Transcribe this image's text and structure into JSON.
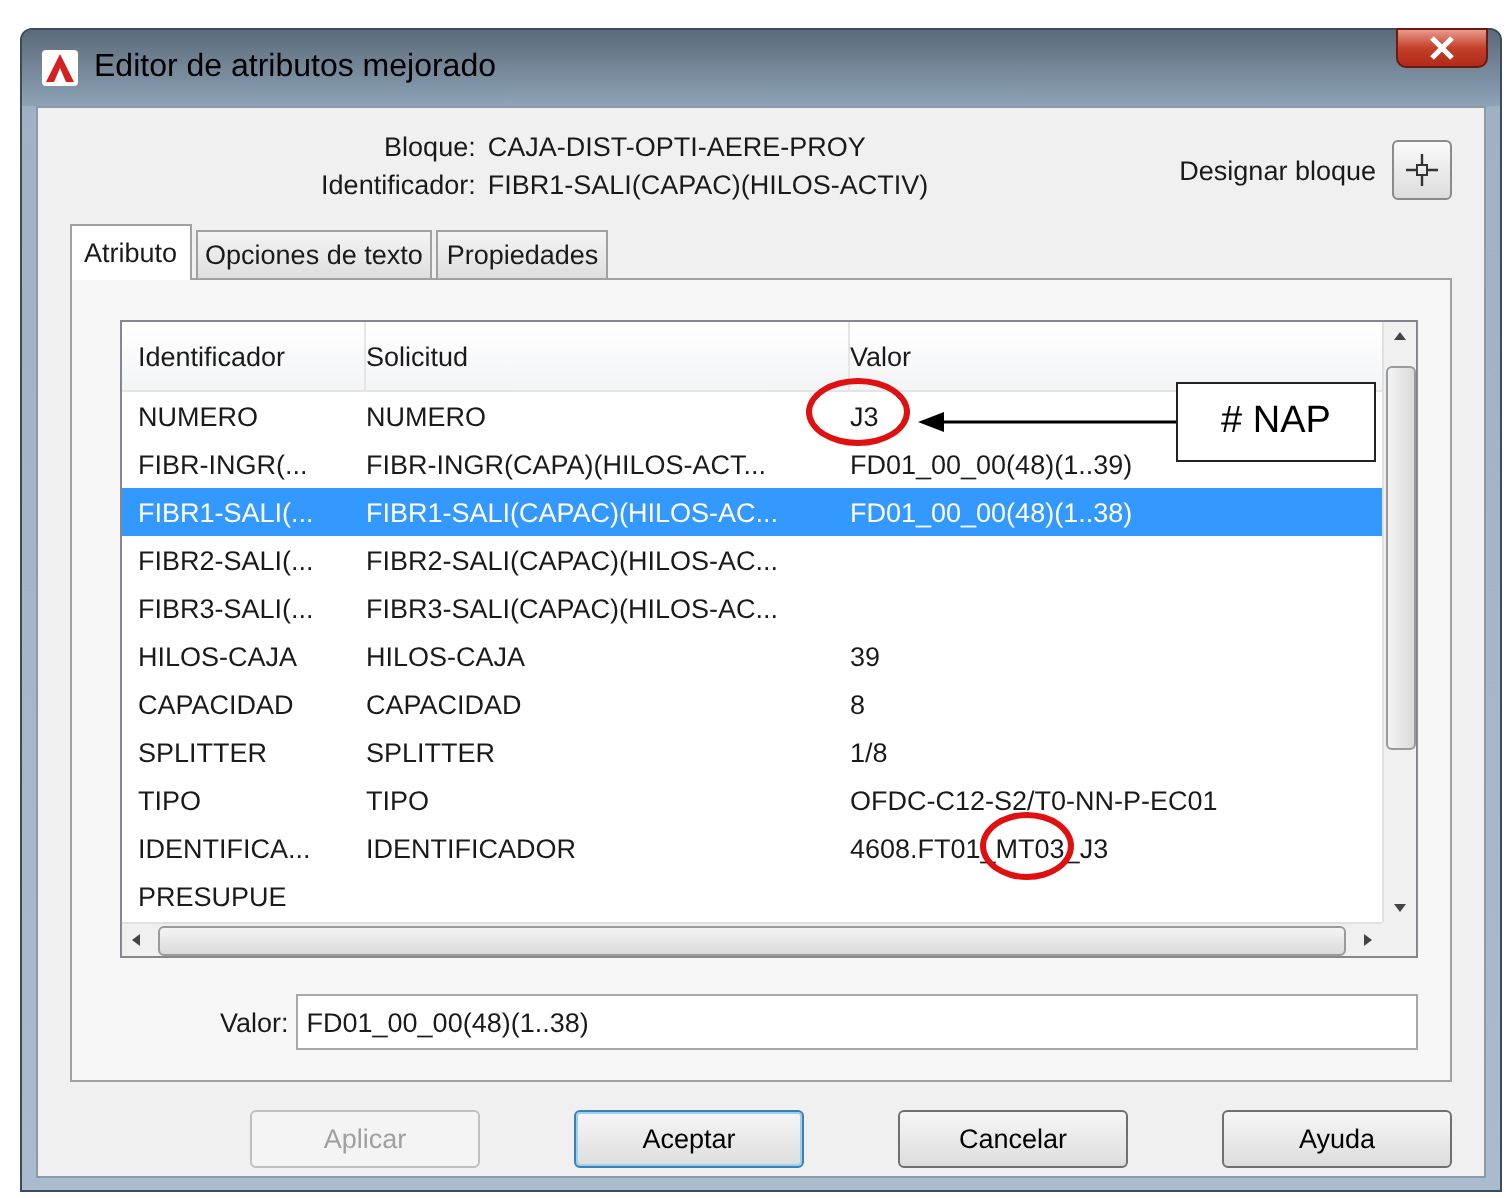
{
  "window": {
    "title": "Editor de atributos mejorado"
  },
  "info": [
    {
      "label": "Bloque:",
      "value": "CAJA-DIST-OPTI-AERE-PROY"
    },
    {
      "label": "Identificador:",
      "value": "FIBR1-SALI(CAPAC)(HILOS-ACTIV)"
    }
  ],
  "select_block": {
    "label": "Designar bloque"
  },
  "tabs": [
    {
      "label": "Atributo",
      "selected": true
    },
    {
      "label": "Opciones de texto",
      "selected": false
    },
    {
      "label": "Propiedades",
      "selected": false
    }
  ],
  "table": {
    "columns": [
      "Identificador",
      "Solicitud",
      "Valor"
    ],
    "rows": [
      {
        "cells": [
          "NUMERO",
          "NUMERO",
          "J3"
        ],
        "selected": false
      },
      {
        "cells": [
          "FIBR-INGR(...",
          "FIBR-INGR(CAPA)(HILOS-ACT...",
          "FD01_00_00(48)(1..39)"
        ],
        "selected": false
      },
      {
        "cells": [
          "FIBR1-SALI(...",
          "FIBR1-SALI(CAPAC)(HILOS-AC...",
          "FD01_00_00(48)(1..38)"
        ],
        "selected": true
      },
      {
        "cells": [
          "FIBR2-SALI(...",
          "FIBR2-SALI(CAPAC)(HILOS-AC...",
          ""
        ],
        "selected": false
      },
      {
        "cells": [
          "FIBR3-SALI(...",
          "FIBR3-SALI(CAPAC)(HILOS-AC...",
          ""
        ],
        "selected": false
      },
      {
        "cells": [
          "HILOS-CAJA",
          "HILOS-CAJA",
          "39"
        ],
        "selected": false
      },
      {
        "cells": [
          "CAPACIDAD",
          "CAPACIDAD",
          "8"
        ],
        "selected": false
      },
      {
        "cells": [
          "SPLITTER",
          "SPLITTER",
          "1/8"
        ],
        "selected": false
      },
      {
        "cells": [
          "TIPO",
          "TIPO",
          "OFDC-C12-S2/T0-NN-P-EC01"
        ],
        "selected": false
      },
      {
        "cells": [
          "IDENTIFICA...",
          "IDENTIFICADOR",
          "4608.FT01_MT03_J3"
        ],
        "selected": false
      },
      {
        "cells": [
          "PRESUPUE",
          "",
          ""
        ],
        "selected": false
      }
    ]
  },
  "callout": {
    "text": "# NAP"
  },
  "value_field": {
    "label": "Valor:",
    "value": "FD01_00_00(48)(1..38)"
  },
  "buttons": [
    {
      "label": "Aplicar",
      "disabled": true,
      "default": false
    },
    {
      "label": "Aceptar",
      "disabled": false,
      "default": true
    },
    {
      "label": "Cancelar",
      "disabled": false,
      "default": false
    },
    {
      "label": "Ayuda",
      "disabled": false,
      "default": false
    }
  ]
}
